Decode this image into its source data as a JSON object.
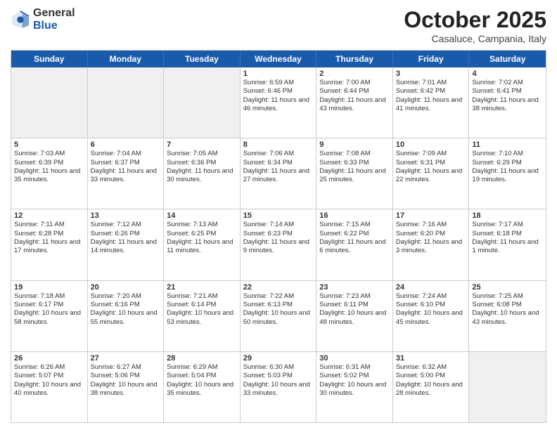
{
  "logo": {
    "general": "General",
    "blue": "Blue"
  },
  "header": {
    "month": "October 2025",
    "location": "Casaluce, Campania, Italy"
  },
  "weekdays": [
    "Sunday",
    "Monday",
    "Tuesday",
    "Wednesday",
    "Thursday",
    "Friday",
    "Saturday"
  ],
  "rows": [
    [
      {
        "day": "",
        "text": ""
      },
      {
        "day": "",
        "text": ""
      },
      {
        "day": "",
        "text": ""
      },
      {
        "day": "1",
        "text": "Sunrise: 6:59 AM\nSunset: 6:46 PM\nDaylight: 11 hours and 46 minutes."
      },
      {
        "day": "2",
        "text": "Sunrise: 7:00 AM\nSunset: 6:44 PM\nDaylight: 11 hours and 43 minutes."
      },
      {
        "day": "3",
        "text": "Sunrise: 7:01 AM\nSunset: 6:42 PM\nDaylight: 11 hours and 41 minutes."
      },
      {
        "day": "4",
        "text": "Sunrise: 7:02 AM\nSunset: 6:41 PM\nDaylight: 11 hours and 38 minutes."
      }
    ],
    [
      {
        "day": "5",
        "text": "Sunrise: 7:03 AM\nSunset: 6:39 PM\nDaylight: 11 hours and 35 minutes."
      },
      {
        "day": "6",
        "text": "Sunrise: 7:04 AM\nSunset: 6:37 PM\nDaylight: 11 hours and 33 minutes."
      },
      {
        "day": "7",
        "text": "Sunrise: 7:05 AM\nSunset: 6:36 PM\nDaylight: 11 hours and 30 minutes."
      },
      {
        "day": "8",
        "text": "Sunrise: 7:06 AM\nSunset: 6:34 PM\nDaylight: 11 hours and 27 minutes."
      },
      {
        "day": "9",
        "text": "Sunrise: 7:08 AM\nSunset: 6:33 PM\nDaylight: 11 hours and 25 minutes."
      },
      {
        "day": "10",
        "text": "Sunrise: 7:09 AM\nSunset: 6:31 PM\nDaylight: 11 hours and 22 minutes."
      },
      {
        "day": "11",
        "text": "Sunrise: 7:10 AM\nSunset: 6:29 PM\nDaylight: 11 hours and 19 minutes."
      }
    ],
    [
      {
        "day": "12",
        "text": "Sunrise: 7:11 AM\nSunset: 6:28 PM\nDaylight: 11 hours and 17 minutes."
      },
      {
        "day": "13",
        "text": "Sunrise: 7:12 AM\nSunset: 6:26 PM\nDaylight: 11 hours and 14 minutes."
      },
      {
        "day": "14",
        "text": "Sunrise: 7:13 AM\nSunset: 6:25 PM\nDaylight: 11 hours and 11 minutes."
      },
      {
        "day": "15",
        "text": "Sunrise: 7:14 AM\nSunset: 6:23 PM\nDaylight: 11 hours and 9 minutes."
      },
      {
        "day": "16",
        "text": "Sunrise: 7:15 AM\nSunset: 6:22 PM\nDaylight: 11 hours and 6 minutes."
      },
      {
        "day": "17",
        "text": "Sunrise: 7:16 AM\nSunset: 6:20 PM\nDaylight: 11 hours and 3 minutes."
      },
      {
        "day": "18",
        "text": "Sunrise: 7:17 AM\nSunset: 6:18 PM\nDaylight: 11 hours and 1 minute."
      }
    ],
    [
      {
        "day": "19",
        "text": "Sunrise: 7:18 AM\nSunset: 6:17 PM\nDaylight: 10 hours and 58 minutes."
      },
      {
        "day": "20",
        "text": "Sunrise: 7:20 AM\nSunset: 6:16 PM\nDaylight: 10 hours and 55 minutes."
      },
      {
        "day": "21",
        "text": "Sunrise: 7:21 AM\nSunset: 6:14 PM\nDaylight: 10 hours and 53 minutes."
      },
      {
        "day": "22",
        "text": "Sunrise: 7:22 AM\nSunset: 6:13 PM\nDaylight: 10 hours and 50 minutes."
      },
      {
        "day": "23",
        "text": "Sunrise: 7:23 AM\nSunset: 6:11 PM\nDaylight: 10 hours and 48 minutes."
      },
      {
        "day": "24",
        "text": "Sunrise: 7:24 AM\nSunset: 6:10 PM\nDaylight: 10 hours and 45 minutes."
      },
      {
        "day": "25",
        "text": "Sunrise: 7:25 AM\nSunset: 6:08 PM\nDaylight: 10 hours and 43 minutes."
      }
    ],
    [
      {
        "day": "26",
        "text": "Sunrise: 6:26 AM\nSunset: 5:07 PM\nDaylight: 10 hours and 40 minutes."
      },
      {
        "day": "27",
        "text": "Sunrise: 6:27 AM\nSunset: 5:06 PM\nDaylight: 10 hours and 38 minutes."
      },
      {
        "day": "28",
        "text": "Sunrise: 6:29 AM\nSunset: 5:04 PM\nDaylight: 10 hours and 35 minutes."
      },
      {
        "day": "29",
        "text": "Sunrise: 6:30 AM\nSunset: 5:03 PM\nDaylight: 10 hours and 33 minutes."
      },
      {
        "day": "30",
        "text": "Sunrise: 6:31 AM\nSunset: 5:02 PM\nDaylight: 10 hours and 30 minutes."
      },
      {
        "day": "31",
        "text": "Sunrise: 6:32 AM\nSunset: 5:00 PM\nDaylight: 10 hours and 28 minutes."
      },
      {
        "day": "",
        "text": ""
      }
    ]
  ]
}
